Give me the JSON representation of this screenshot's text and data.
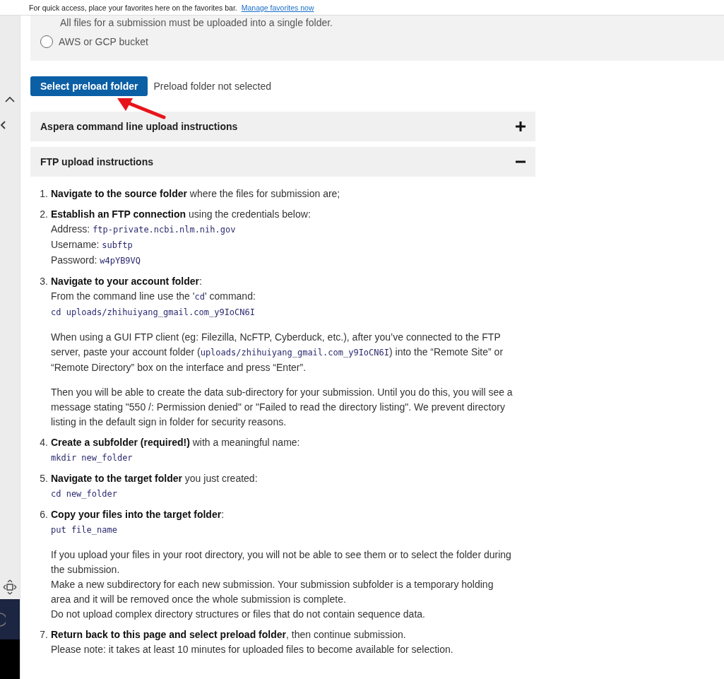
{
  "favorites_bar": {
    "message": "For quick access, place your favorites here on the favorites bar.",
    "link": "Manage favorites now"
  },
  "upload_options": {
    "note": "All files for a submission must be uploaded into a single folder.",
    "options": [
      {
        "label": "AWS or GCP bucket",
        "selected": false
      }
    ]
  },
  "preload": {
    "button": "Select preload folder",
    "status": "Preload folder not selected"
  },
  "accordions": [
    {
      "title": "Aspera command line upload instructions",
      "expanded": false
    },
    {
      "title": "FTP upload instructions",
      "expanded": true
    }
  ],
  "steps": [
    {
      "number": "1.",
      "heading": "**Navigate to the source folder** where the files for submission are;"
    },
    {
      "number": "2.",
      "heading": "**Establish an FTP connection** using the credentials below:",
      "blocks": [
        {
          "kind": "line",
          "parts": [
            {
              "text": "Address: ",
              "code": false
            },
            {
              "text": "ftp-private.ncbi.nlm.nih.gov",
              "code": true
            }
          ]
        },
        {
          "kind": "line",
          "parts": [
            {
              "text": "Username: ",
              "code": false
            },
            {
              "text": "subftp",
              "code": true
            }
          ]
        },
        {
          "kind": "line",
          "parts": [
            {
              "text": "Password: ",
              "code": false
            },
            {
              "text": "w4pYB9VQ",
              "code": true
            }
          ]
        }
      ]
    },
    {
      "number": "3.",
      "heading": "**Navigate to your account folder**:",
      "blocks": [
        {
          "kind": "line",
          "parts": [
            {
              "text": "From the command line use the '",
              "code": false
            },
            {
              "text": "cd",
              "code": true
            },
            {
              "text": "' command:",
              "code": false
            }
          ]
        },
        {
          "kind": "line",
          "parts": [
            {
              "text": "cd uploads/zhihuiyang_gmail.com_y9IoCN6I",
              "code": true
            }
          ]
        },
        {
          "kind": "para",
          "parts": [
            {
              "text": "When using a GUI FTP client (eg: Filezilla, NcFTP, Cyberduck, etc.), after you’ve connected to the FTP server, paste your account folder (",
              "code": false
            },
            {
              "text": "uploads/zhihuiyang_gmail.com_y9IoCN6I",
              "code": true
            },
            {
              "text": ") into the “Remote Site” or “Remote Directory” box on the interface and press “Enter”.",
              "code": false
            }
          ]
        },
        {
          "kind": "para",
          "parts": [
            {
              "text": "Then you will be able to create the data sub-directory for your submission. Until you do this, you will see a message stating \"550 /: Permission denied\" or \"Failed to read the directory listing\". We prevent directory listing in the default sign in folder for security reasons.",
              "code": false
            }
          ]
        }
      ]
    },
    {
      "number": "4.",
      "heading": "**Create a subfolder (required!)** with a meaningful name:",
      "blocks": [
        {
          "kind": "line",
          "parts": [
            {
              "text": "mkdir new_folder",
              "code": true
            }
          ]
        }
      ]
    },
    {
      "number": "5.",
      "heading": "**Navigate to the target folder** you just created:",
      "blocks": [
        {
          "kind": "line",
          "parts": [
            {
              "text": "cd new_folder",
              "code": true
            }
          ]
        }
      ]
    },
    {
      "number": "6.",
      "heading": "**Copy your files into the target folder**:",
      "blocks": [
        {
          "kind": "line",
          "parts": [
            {
              "text": "put file_name",
              "code": true
            }
          ]
        },
        {
          "kind": "para",
          "parts": [
            {
              "text": "If you upload your files in your root directory, you will not be able to see them or to select the folder during the submission.",
              "code": false
            }
          ]
        },
        {
          "kind": "line",
          "parts": [
            {
              "text": "Make a new subdirectory for each new submission. Your submission subfolder is a temporary holding area and it will be removed once the whole submission is complete.",
              "code": false
            }
          ]
        },
        {
          "kind": "line",
          "parts": [
            {
              "text": "Do not upload complex directory structures or files that do not contain sequence data.",
              "code": false
            }
          ]
        }
      ]
    },
    {
      "number": "7.",
      "heading": "**Return back to this page and select preload folder**, then continue submission.",
      "blocks": [
        {
          "kind": "line",
          "parts": [
            {
              "text": "Please note: it takes at least 10 minutes for uploaded files to become available for selection.",
              "code": false
            }
          ]
        }
      ]
    }
  ]
}
